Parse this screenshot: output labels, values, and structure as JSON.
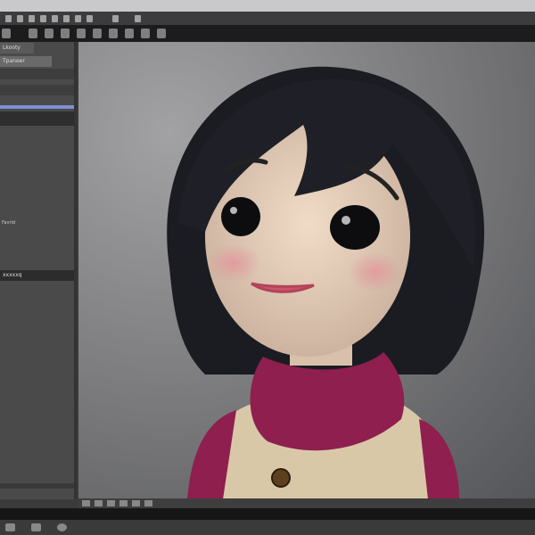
{
  "panel": {
    "field1": "Lkooty",
    "field2": "Tpaneer",
    "group_label": "Favrid",
    "section_label": "xxxxxq"
  },
  "viewport": {
    "subject": "cartoon doll character with black bob hair, magenta scarf and beige vest"
  },
  "colors": {
    "toolbar": "#1c1c1c",
    "panel": "#4a4a4b",
    "accent": "#7d8fd6",
    "scarf": "#8e1f4e",
    "vest": "#d9c8a8"
  }
}
